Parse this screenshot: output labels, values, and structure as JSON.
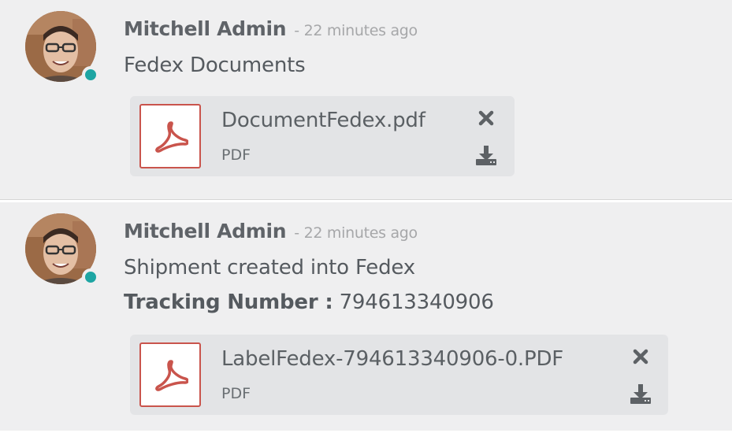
{
  "messages": [
    {
      "author": "Mitchell Admin",
      "date": "- 22 minutes ago",
      "body": [
        "Fedex Documents"
      ],
      "attachment": {
        "name": "DocumentFedex.pdf",
        "type": "PDF",
        "icon": "pdf-file-icon"
      }
    },
    {
      "author": "Mitchell Admin",
      "date": "- 22 minutes ago",
      "body": [
        "Shipment created into Fedex"
      ],
      "tracking": {
        "label": "Tracking Number :",
        "value": "794613340906"
      },
      "attachment": {
        "name": "LabelFedex-794613340906-0.PDF",
        "type": "PDF",
        "icon": "pdf-file-icon"
      }
    }
  ],
  "colors": {
    "presence": "#1ea5a3",
    "pdf_accent": "#c9544c",
    "message_bg": "#efeff0",
    "attachment_bg": "#e3e4e6"
  },
  "icons": {
    "remove": "close-icon",
    "download": "download-icon",
    "presence": "online-status-icon"
  }
}
